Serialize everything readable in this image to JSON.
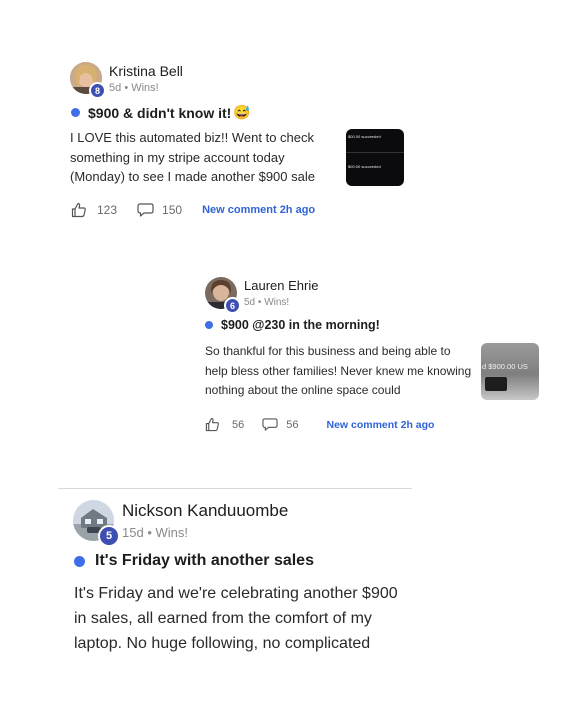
{
  "posts": [
    {
      "author": "Kristina Bell",
      "level": "8",
      "age": "5d",
      "category": "Wins!",
      "title": "$900 & didn't know it!",
      "emoji": "😅",
      "body": "I LOVE this automated biz!! Went to check something in my stripe account today (Monday) to see I made another $900 sale",
      "thumb_lines": [
        "$00.00 succeeded",
        "$00.00 succeeded"
      ],
      "likes": "123",
      "comments": "150",
      "new_comment": "New comment 2h ago"
    },
    {
      "author": "Lauren Ehrie",
      "level": "6",
      "age": "5d",
      "category": "Wins!",
      "title": "$900 @230 in the morning!",
      "body": "So thankful for this business and being able to help bless other families! Never knew me knowing nothing about the online space could",
      "thumb_text": "d $900.00 US",
      "likes": "56",
      "comments": "56",
      "new_comment": "New comment 2h ago"
    },
    {
      "author": "Nickson Kanduuombe",
      "level": "5",
      "age": "15d",
      "category": "Wins!",
      "title": "It's Friday with another sales",
      "body": "It's Friday and we're celebrating another $900 in sales, all earned from the comfort of my laptop. No huge following, no complicated"
    }
  ],
  "separator": "•",
  "colors": {
    "accent": "#2f63d8",
    "dot": "#3f6ee8",
    "badge": "#3d4fb0"
  }
}
